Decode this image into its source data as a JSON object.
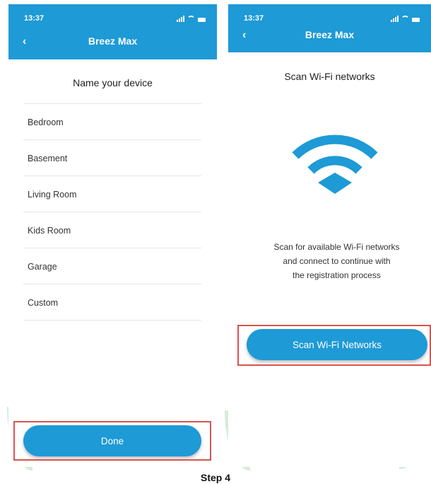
{
  "left_screen": {
    "status_time": "13:37",
    "back_symbol": "‹",
    "title": "Breez Max",
    "heading": "Name your device",
    "items": [
      "Bedroom",
      "Basement",
      "Living Room",
      "Kids Room",
      "Garage",
      "Custom"
    ],
    "done_label": "Done"
  },
  "right_screen": {
    "status_time": "13:37",
    "back_symbol": "‹",
    "title": "Breez Max",
    "heading": "Scan Wi-Fi networks",
    "description_lines": [
      "Scan for available Wi-Fi networks",
      "and connect to continue with",
      "the registration process"
    ],
    "scan_label": "Scan Wi-Fi Networks"
  },
  "caption": "Step 4",
  "colors": {
    "brand_blue": "#1e9ad6",
    "highlight_red": "#d9534f",
    "watermark_green": "#d4ecda"
  },
  "icons": [
    "back-chevron-icon",
    "signal-icon",
    "wifi-status-icon",
    "battery-icon",
    "wifi-icon"
  ]
}
